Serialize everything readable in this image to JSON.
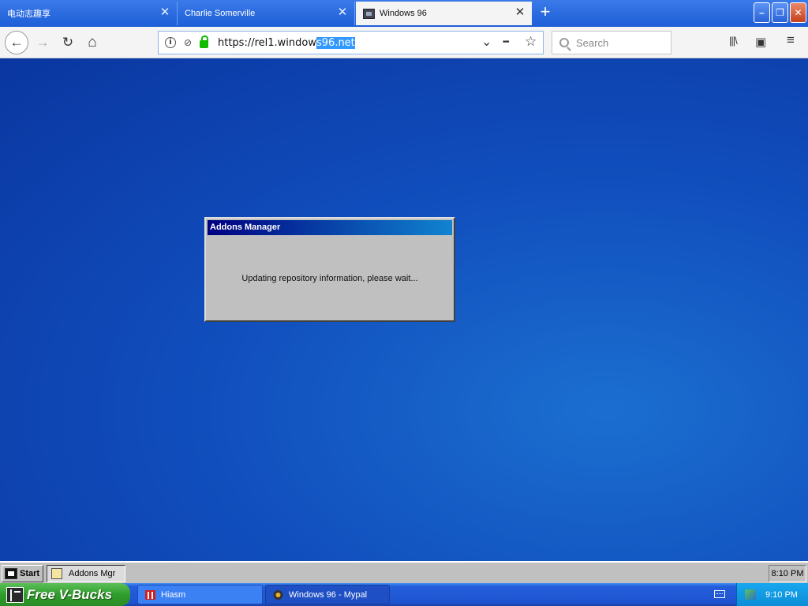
{
  "browser": {
    "tabs": [
      {
        "title": "电动志趣享",
        "active": false
      },
      {
        "title": "Charlie Somerville",
        "active": false
      },
      {
        "title": "Windows 96",
        "active": true
      }
    ],
    "tab_close_glyph": "✕",
    "new_tab_glyph": "+",
    "window_buttons": {
      "minimize": "–",
      "maximize": "❐",
      "close": "✕"
    },
    "nav": {
      "back_glyph": "←",
      "forward_glyph": "→",
      "reload_glyph": "↻",
      "home_glyph": "⌂"
    },
    "url": {
      "prefix": "https://rel1.window",
      "selected": "s96.net"
    },
    "url_actions": {
      "dropdown_glyph": "⌄",
      "more_glyph": "•••",
      "bookmark_glyph": "☆"
    },
    "search": {
      "placeholder": "Search"
    },
    "toolbar": {
      "library_glyph": "|||\\",
      "sidebar_glyph": "▣",
      "menu_glyph": "≡"
    }
  },
  "dialog": {
    "title": "Addons Manager",
    "message": "Updating repository information, please wait..."
  },
  "win96_taskbar": {
    "start_label": "Start",
    "task_label": "Addons Mgr",
    "clock": "8:10 PM"
  },
  "xp_taskbar": {
    "start_label": "Free V-Bucks",
    "tasks": [
      {
        "label": "Hiasm"
      },
      {
        "label": "Windows 96 - Mypal"
      }
    ],
    "clock": "9:10 PM"
  },
  "colors": {
    "win96_title_start": "#000080",
    "win96_title_end": "#1084d0",
    "xp_taskbar": "#245edb",
    "xp_start_green": "#2f9d2b",
    "lock_green": "#12bc00",
    "url_selection": "#3399ff"
  }
}
